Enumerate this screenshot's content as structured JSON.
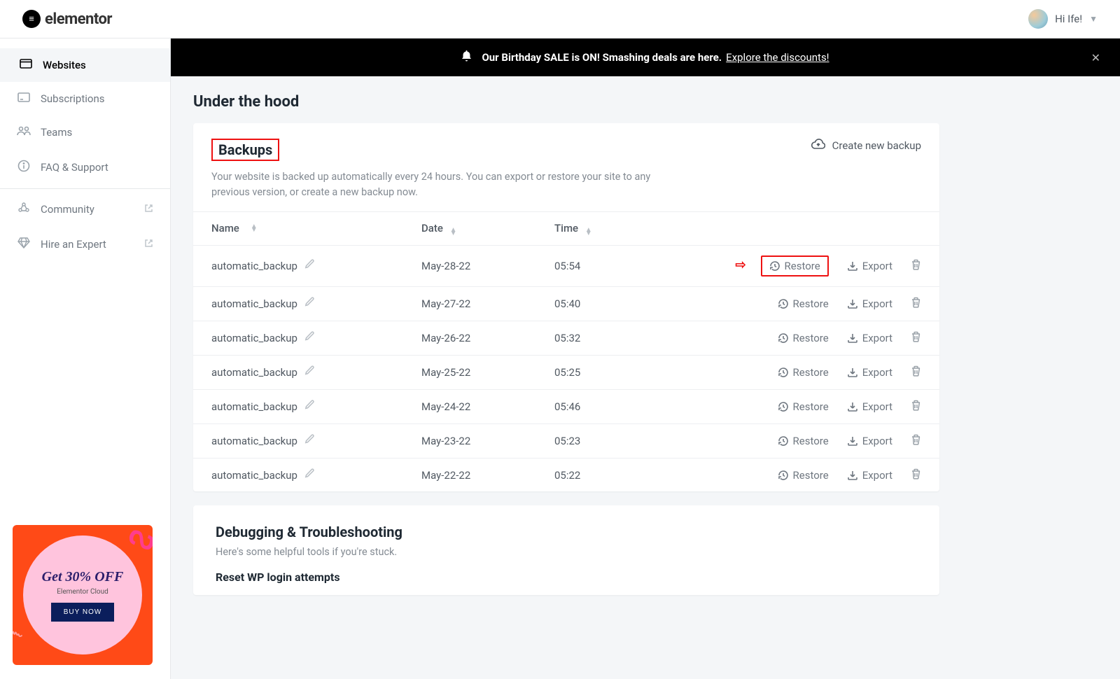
{
  "brand": "elementor",
  "user": {
    "greeting": "Hi Ife!"
  },
  "banner": {
    "text": "Our Birthday SALE is ON! Smashing deals are here.",
    "link": "Explore the discounts!"
  },
  "sidebar": {
    "items": [
      {
        "label": "Websites"
      },
      {
        "label": "Subscriptions"
      },
      {
        "label": "Teams"
      },
      {
        "label": "FAQ & Support"
      },
      {
        "label": "Community"
      },
      {
        "label": "Hire an Expert"
      }
    ]
  },
  "promo": {
    "headline": "Get 30% OFF",
    "sub": "Elementor Cloud",
    "button": "BUY NOW"
  },
  "page": {
    "title": "Under the hood"
  },
  "backups": {
    "title": "Backups",
    "desc": "Your website is backed up automatically every 24 hours. You can export or restore your site to any previous version, or create a new backup now.",
    "create": "Create new backup",
    "cols": {
      "name": "Name",
      "date": "Date",
      "time": "Time"
    },
    "restore": "Restore",
    "export": "Export",
    "rows": [
      {
        "name": "automatic_backup",
        "date": "May-28-22",
        "time": "05:54",
        "highlight": true
      },
      {
        "name": "automatic_backup",
        "date": "May-27-22",
        "time": "05:40"
      },
      {
        "name": "automatic_backup",
        "date": "May-26-22",
        "time": "05:32"
      },
      {
        "name": "automatic_backup",
        "date": "May-25-22",
        "time": "05:25"
      },
      {
        "name": "automatic_backup",
        "date": "May-24-22",
        "time": "05:46"
      },
      {
        "name": "automatic_backup",
        "date": "May-23-22",
        "time": "05:23"
      },
      {
        "name": "automatic_backup",
        "date": "May-22-22",
        "time": "05:22"
      }
    ]
  },
  "debug": {
    "title": "Debugging & Troubleshooting",
    "desc": "Here's some helpful tools if you're stuck.",
    "sub": "Reset WP login attempts"
  }
}
